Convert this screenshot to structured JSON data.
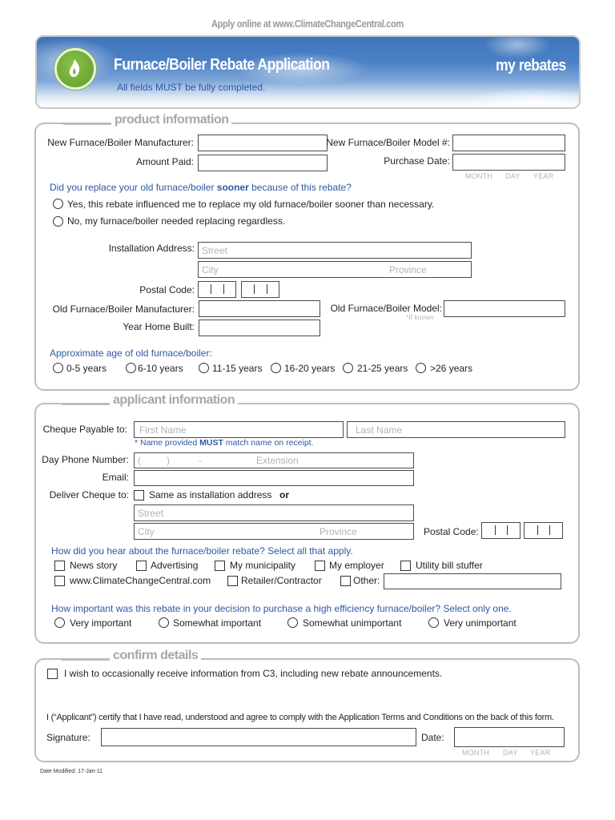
{
  "top_note": "Apply online at www.ClimateChangeCentral.com",
  "banner": {
    "logo_icon": "flame-icon",
    "title": "Furnace/Boiler Rebate Application",
    "subtitle": "All fields MUST be fully completed.",
    "right_text": "my rebates",
    "colors": {
      "sky": "#3f75bb",
      "logo_green": "#6fae35",
      "subtitle_blue": "#2c59a3"
    }
  },
  "product": {
    "section_title": "product information",
    "new_manufacturer_label": "New Furnace/Boiler Manufacturer:",
    "new_manufacturer_value": "",
    "new_model_label": "New Furnace/Boiler Model #:",
    "new_model_value": "",
    "amount_paid_label": "Amount Paid:",
    "amount_paid_value": "",
    "purchase_date_label": "Purchase Date:",
    "purchase_date_value": "",
    "date_hints": {
      "month": "MONTH",
      "day": "DAY",
      "year": "YEAR"
    },
    "sooner_question": {
      "pre": "Did you replace your old furnace/boiler ",
      "bold": "sooner",
      "post": " because of this rebate?"
    },
    "sooner_options": [
      "Yes, this rebate influenced me to replace my old furnace/boiler sooner than necessary.",
      "No, my furnace/boiler needed replacing regardless."
    ],
    "install_address_label": "Installation Address:",
    "street_placeholder": "Street",
    "city_placeholder": "City",
    "province_placeholder": "Province",
    "postal_code_label": "Postal Code:",
    "old_manufacturer_label": "Old Furnace/Boiler Manufacturer:",
    "old_model_label": "Old Furnace/Boiler Model:",
    "old_model_hint": "*If known",
    "year_built_label": "Year Home Built:",
    "age_question": "Approximate age of old furnace/boiler:",
    "age_options": [
      "0-5 years",
      "6-10 years",
      "11-15 years",
      "16-20 years",
      "21-25 years",
      ">26 years"
    ]
  },
  "applicant": {
    "section_title": "applicant information",
    "cheque_payable_label": "Cheque Payable to:",
    "first_name_placeholder": "First Name",
    "last_name_placeholder": "Last Name",
    "name_note": {
      "pre": "* Name provided ",
      "bold": "MUST",
      "post": " match name on receipt."
    },
    "phone_label": "Day Phone Number:",
    "phone_placeholder": {
      "open": "(",
      "close": ")",
      "dash": "-",
      "extension": "Extension"
    },
    "email_label": "Email:",
    "deliver_label": "Deliver Cheque to:",
    "same_as_install": "Same as installation address",
    "or_text": "or",
    "street_placeholder": "Street",
    "city_placeholder": "City",
    "province_placeholder": "Province",
    "postal_code_label": "Postal Code:",
    "hear_question": "How did you hear about the furnace/boiler rebate? Select all that apply.",
    "hear_options_row1": [
      "News story",
      "Advertising",
      "My municipality",
      "My employer",
      "Utility bill stuffer"
    ],
    "hear_options_row2": [
      "www.ClimateChangeCentral.com",
      "Retailer/Contractor",
      "Other:"
    ],
    "importance_question": "How important was this rebate in your decision to purchase a high efficiency furnace/boiler?  Select only one.",
    "importance_options": [
      "Very important",
      "Somewhat important",
      "Somewhat unimportant",
      "Very unimportant"
    ]
  },
  "confirm": {
    "section_title": "confirm details",
    "optin_text": "I wish to occasionally receive information from C3, including new rebate announcements.",
    "certify_text": "I (“Applicant”) certify that I have read, understood and agree to comply with the Application Terms and Conditions on the back of this form.",
    "signature_label": "Signature:",
    "date_label": "Date:",
    "date_hints": {
      "month": "MONTH",
      "day": "DAY",
      "year": "YEAR"
    }
  },
  "footer": "Date Modified: 17-Jan-11"
}
